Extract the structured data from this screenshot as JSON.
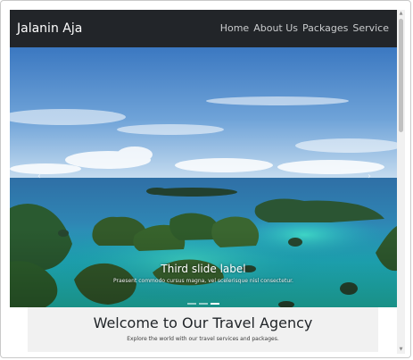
{
  "navbar": {
    "brand": "Jalanin Aja",
    "links": [
      "Home",
      "About Us",
      "Packages",
      "Service"
    ]
  },
  "carousel": {
    "caption_title": "Third slide label",
    "caption_text": "Praesent commodo cursus magna, vel scelerisque nisl consectetur.",
    "slide_count": 3,
    "active_slide": 3,
    "prev_icon": "chevron-left-icon",
    "next_icon": "chevron-right-icon"
  },
  "welcome": {
    "title": "Welcome to Our Travel Agency",
    "subtitle": "Explore the world with our travel services and packages."
  },
  "colors": {
    "navbar_bg": "#222529",
    "sea": "#1aa4c1",
    "sky": "#4a86c8",
    "welcome_bg": "#f1f1f1"
  }
}
